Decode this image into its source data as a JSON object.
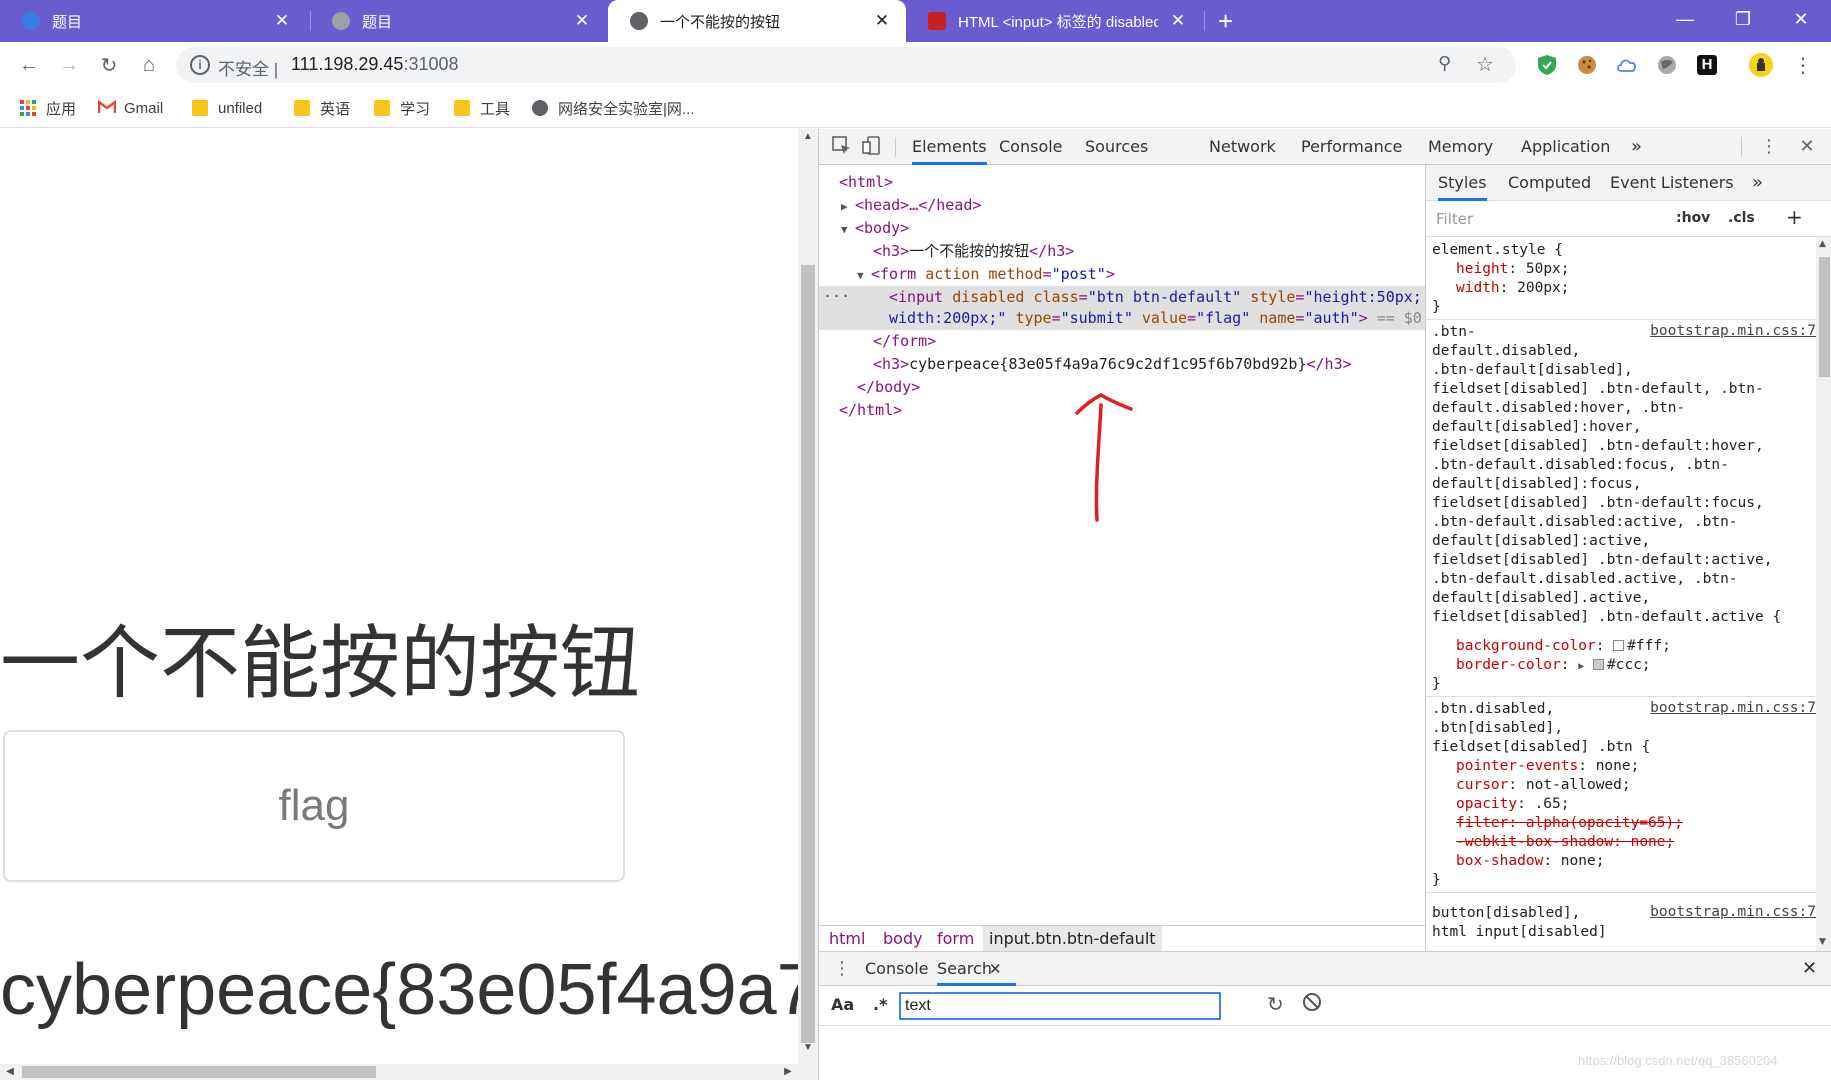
{
  "browser": {
    "tabs": [
      {
        "title": "题目",
        "favicon_color": "#3b7be8",
        "active": false
      },
      {
        "title": "题目",
        "favicon_color": "#9aa0a6",
        "active": false
      },
      {
        "title": "一个不能按的按钮",
        "favicon_color": "#5f6368",
        "active": true
      },
      {
        "title": "HTML <input> 标签的 disabled",
        "favicon_color": "#c5221f",
        "active": false
      }
    ],
    "tab_close_glyph": "✕",
    "new_tab_glyph": "+",
    "window_controls": [
      "—",
      "❐",
      "✕"
    ],
    "address": {
      "security": "不安全",
      "separator": "|",
      "host": "111.198.29.45",
      "port": ":31008"
    },
    "bookmarks": [
      {
        "label": "应用",
        "icon": "apps-grid-icon"
      },
      {
        "label": "Gmail",
        "icon": "gmail-icon"
      },
      {
        "label": "unfiled",
        "icon": "folder-icon"
      },
      {
        "label": "英语",
        "icon": "folder-icon"
      },
      {
        "label": "学习",
        "icon": "folder-icon"
      },
      {
        "label": "工具",
        "icon": "folder-icon"
      },
      {
        "label": "网络安全实验室|网...",
        "icon": "globe-icon"
      }
    ]
  },
  "page": {
    "heading": "一个不能按的按钮",
    "button_value": "flag",
    "flag_text": "cyberpeace{83e05f4a9a76c9c2df1c95f6b70bd92b}"
  },
  "devtools": {
    "tabs": [
      "Elements",
      "Console",
      "Sources",
      "Network",
      "Performance",
      "Memory",
      "Application"
    ],
    "more": "»",
    "dom": {
      "html_open": "<html>",
      "head": "<head>…</head>",
      "body_open": "<body>",
      "h3_1_text": "一个不能按的按钮",
      "form_action": "action",
      "form_method_attr": "method",
      "form_method_val": "post",
      "input_attrs": {
        "disabled": "disabled",
        "class_name": "class",
        "class_val": "btn btn-default",
        "style_name": "style",
        "style_val_1": "height:50px;",
        "style_val_2": "width:200px;",
        "type_name": "type",
        "type_val": "submit",
        "value_name": "value",
        "value_val": "flag",
        "name_name": "name",
        "name_val": "auth",
        "eq_dollar": "== $0"
      },
      "form_close": "</form>",
      "h3_2_text": "cyberpeace{83e05f4a9a76c9c2df1c95f6b70bd92b}",
      "body_close": "</body>",
      "html_close": "</html>",
      "ellipsis": "..."
    },
    "breadcrumbs": [
      "html",
      "body",
      "form",
      "input.btn.btn-default"
    ],
    "styles": {
      "tabs": [
        "Styles",
        "Computed",
        "Event Listeners"
      ],
      "more": "»",
      "filter_placeholder": "Filter",
      "hov": ":hov",
      "cls": ".cls",
      "add": "+",
      "rules": {
        "r1_selector": "element.style {",
        "r1_props": [
          [
            "height",
            "50px;"
          ],
          [
            "width",
            "200px;"
          ]
        ],
        "r2_source": "bootstrap.min.css:7",
        "r2_selectors": [
          ".btn-",
          "default.disabled,",
          ".btn-default[disabled],",
          "fieldset[disabled] .btn-default, .btn-",
          "default.disabled:hover, .btn-",
          "default[disabled]:hover,",
          "fieldset[disabled] .btn-default:hover,",
          ".btn-default.disabled:focus, .btn-",
          "default[disabled]:focus,",
          "fieldset[disabled] .btn-default:focus,",
          ".btn-default.disabled:active, .btn-",
          "default[disabled]:active,",
          "fieldset[disabled] .btn-default:active,",
          ".btn-default.disabled.active, .btn-",
          "default[disabled].active,",
          "fieldset[disabled] .btn-default.active {"
        ],
        "r2_props": [
          [
            "background-color",
            "#fff;"
          ],
          [
            "border-color",
            "#ccc;"
          ]
        ],
        "r2_swatches": [
          "#ffffff",
          "#cccccc"
        ],
        "r3_source": "bootstrap.min.css:7",
        "r3_selectors": [
          ".btn.disabled,",
          ".btn[disabled],",
          "fieldset[disabled] .btn {"
        ],
        "r3_props": [
          [
            "pointer-events",
            "none;"
          ],
          [
            "cursor",
            "not-allowed;"
          ],
          [
            "opacity",
            ".65;"
          ]
        ],
        "r3_struck": [
          "filter: alpha(opacity=65);",
          "-webkit-box-shadow: none;"
        ],
        "r3_last": [
          "box-shadow",
          "none;"
        ],
        "r4_source": "bootstrap.min.css:7",
        "r4_selectors": [
          "button[disabled],",
          "html input[disabled]"
        ],
        "close_brace": "}"
      }
    },
    "drawer": {
      "tabs": [
        "Console",
        "Search"
      ],
      "case_toggle": "Aa",
      "regex_toggle": ".*",
      "search_value": "text"
    }
  },
  "watermark": "https://blog.csdn.net/qq_38560204",
  "colors": {
    "tabstrip": "#6a5bd1",
    "annotation_arrow": "#e02020",
    "selection_blue": "#1a73e8"
  }
}
